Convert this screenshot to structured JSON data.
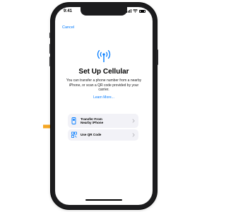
{
  "status_bar": {
    "time": "9:41"
  },
  "nav": {
    "cancel_label": "Cancel"
  },
  "icons": {
    "cellular": "antenna-icon",
    "transfer": "phone-icon",
    "qr": "qr-code-icon",
    "chevron": "chevron-right-icon",
    "arrow": "arrow-right-icon"
  },
  "setup": {
    "title": "Set Up Cellular",
    "description": "You can transfer a phone number from a nearby iPhone, or scan a QR code provided by your carrier.",
    "learn_more": "Learn More...",
    "options": [
      {
        "line1": "Transfer From",
        "line2": "Nearby iPhone"
      },
      {
        "label": "Use QR Code"
      }
    ]
  },
  "colors": {
    "accent": "#007aff",
    "arrow": "#f5a623",
    "option_bg": "#f2f2f7",
    "phone_frame": "#1c1c1e"
  }
}
